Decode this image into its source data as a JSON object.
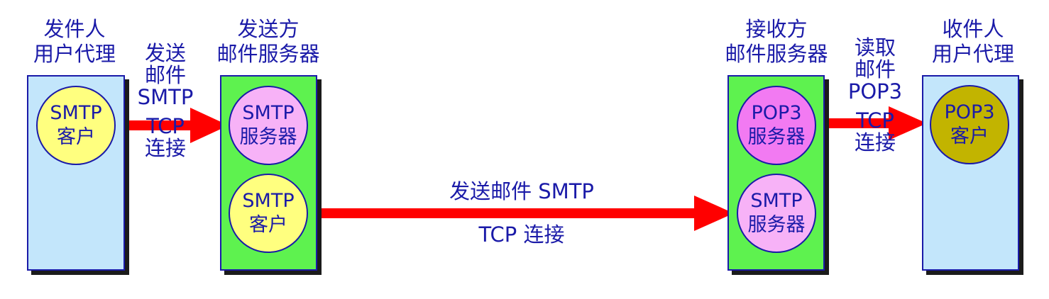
{
  "colors": {
    "text": "#1a1aa8",
    "arrow": "#ff0000",
    "client_box": "#c3e6fb",
    "server_box": "#5ef24f",
    "smtp_client_circle": "#ffff7f",
    "smtp_server_circle": "#f7b2f7",
    "pop3_server_circle": "#f27af2",
    "pop3_client_circle": "#c2b400"
  },
  "nodes": {
    "sender_ua": {
      "title": [
        "发件人",
        "用户代理"
      ],
      "circle": [
        "SMTP",
        "客户"
      ]
    },
    "sender_server": {
      "title": [
        "发送方",
        "邮件服务器"
      ],
      "circle_top": [
        "SMTP",
        "服务器"
      ],
      "circle_bottom": [
        "SMTP",
        "客户"
      ]
    },
    "receiver_server": {
      "title": [
        "接收方",
        "邮件服务器"
      ],
      "circle_top": [
        "POP3",
        "服务器"
      ],
      "circle_bottom": [
        "SMTP",
        "服务器"
      ]
    },
    "receiver_ua": {
      "title": [
        "收件人",
        "用户代理"
      ],
      "circle": [
        "POP3",
        "客户"
      ]
    }
  },
  "edges": {
    "send_mail": {
      "lines": [
        "发送",
        "邮件",
        "SMTP",
        "TCP",
        "连接"
      ]
    },
    "relay_mail": {
      "protocol": "发送邮件 SMTP",
      "connection": "TCP 连接"
    },
    "read_mail": {
      "lines": [
        "读取",
        "邮件",
        "POP3",
        "TCP",
        "连接"
      ]
    }
  }
}
